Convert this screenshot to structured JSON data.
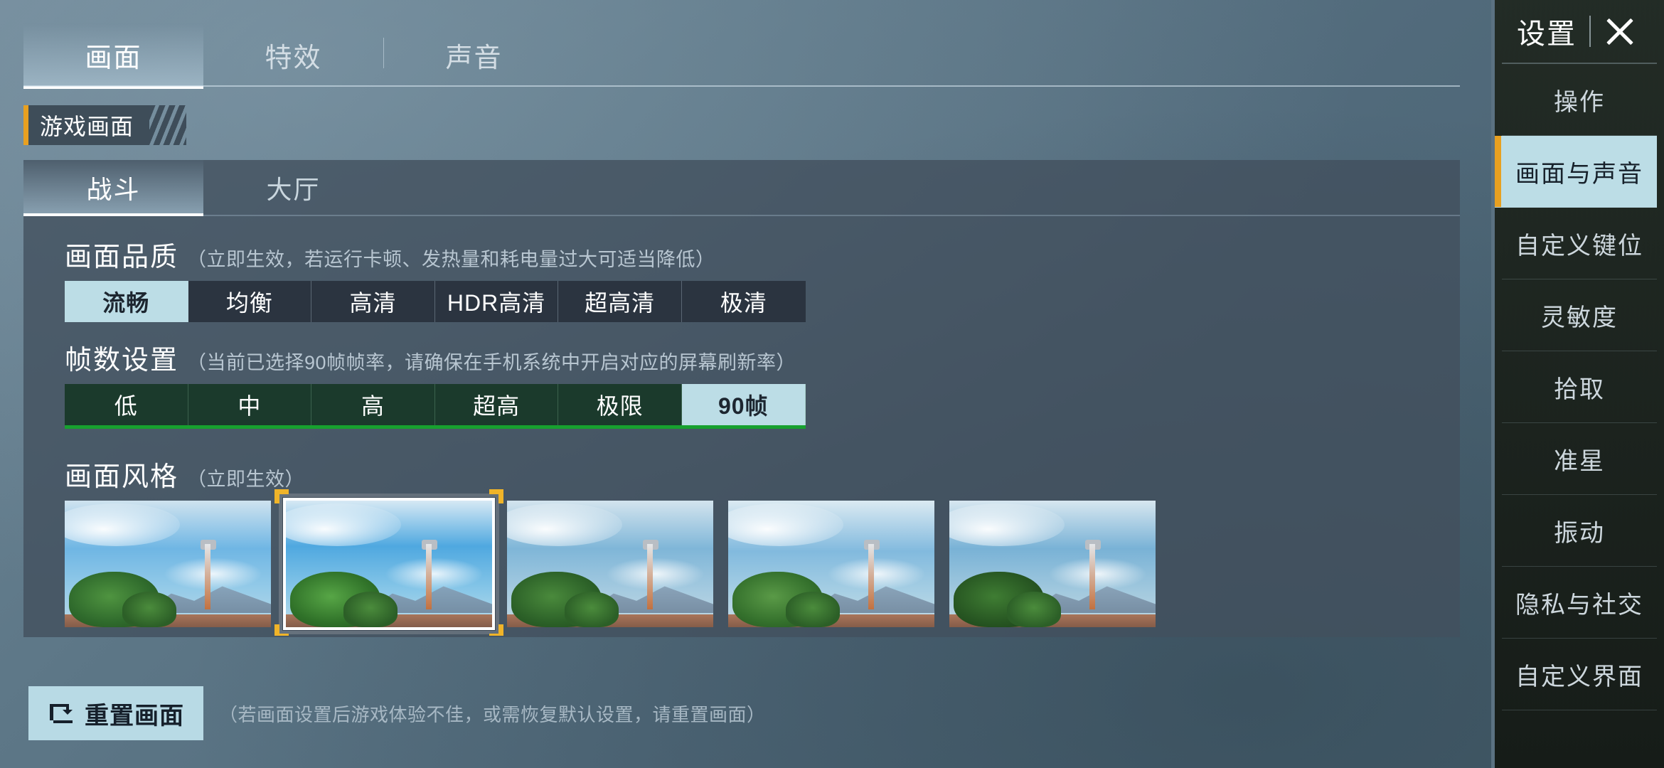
{
  "top_tabs": [
    {
      "label": "画面",
      "active": true
    },
    {
      "label": "特效",
      "active": false
    },
    {
      "label": "声音",
      "active": false
    }
  ],
  "section_chip": {
    "label": "游戏画面"
  },
  "sub_tabs": [
    {
      "label": "战斗",
      "active": true
    },
    {
      "label": "大厅",
      "active": false
    }
  ],
  "quality": {
    "title": "画面品质",
    "desc": "（立即生效，若运行卡顿、发热量和耗电量过大可适当降低）",
    "options": [
      "流畅",
      "均衡",
      "高清",
      "HDR高清",
      "超高清",
      "极清"
    ],
    "selected": "流畅",
    "selected_bg": "#bcdde6"
  },
  "framerate": {
    "title": "帧数设置",
    "desc": "（当前已选择90帧帧率，请确保在手机系统中开启对应的屏幕刷新率）",
    "options": [
      "低",
      "中",
      "高",
      "超高",
      "极限",
      "90帧"
    ],
    "selected": "90帧",
    "group_bg": "#1b3a2c",
    "accent": "#17a12f"
  },
  "style": {
    "title": "画面风格",
    "desc": "（立即生效）",
    "thumbnails": [
      {
        "name": "style-1",
        "selected": false
      },
      {
        "name": "style-2",
        "selected": true
      },
      {
        "name": "style-3",
        "selected": false
      },
      {
        "name": "style-4",
        "selected": false
      },
      {
        "name": "style-5",
        "selected": false
      }
    ],
    "selected_index": 1,
    "selection_corner_color": "#f0b429"
  },
  "reset": {
    "label": "重置画面",
    "icon": "reset-icon",
    "desc": "（若画面设置后游戏体验不佳，或需恢复默认设置，请重置画面）",
    "bg": "#b8dae5"
  },
  "sidebar": {
    "title": "设置",
    "close_icon": "close-icon",
    "accent": "#e8a020",
    "active_bg": "#bcdde6",
    "items": [
      {
        "label": "操作",
        "active": false
      },
      {
        "label": "画面与声音",
        "active": true
      },
      {
        "label": "自定义键位",
        "active": false
      },
      {
        "label": "灵敏度",
        "active": false
      },
      {
        "label": "拾取",
        "active": false
      },
      {
        "label": "准星",
        "active": false
      },
      {
        "label": "振动",
        "active": false
      },
      {
        "label": "隐私与社交",
        "active": false
      },
      {
        "label": "自定义界面",
        "active": false
      }
    ]
  }
}
